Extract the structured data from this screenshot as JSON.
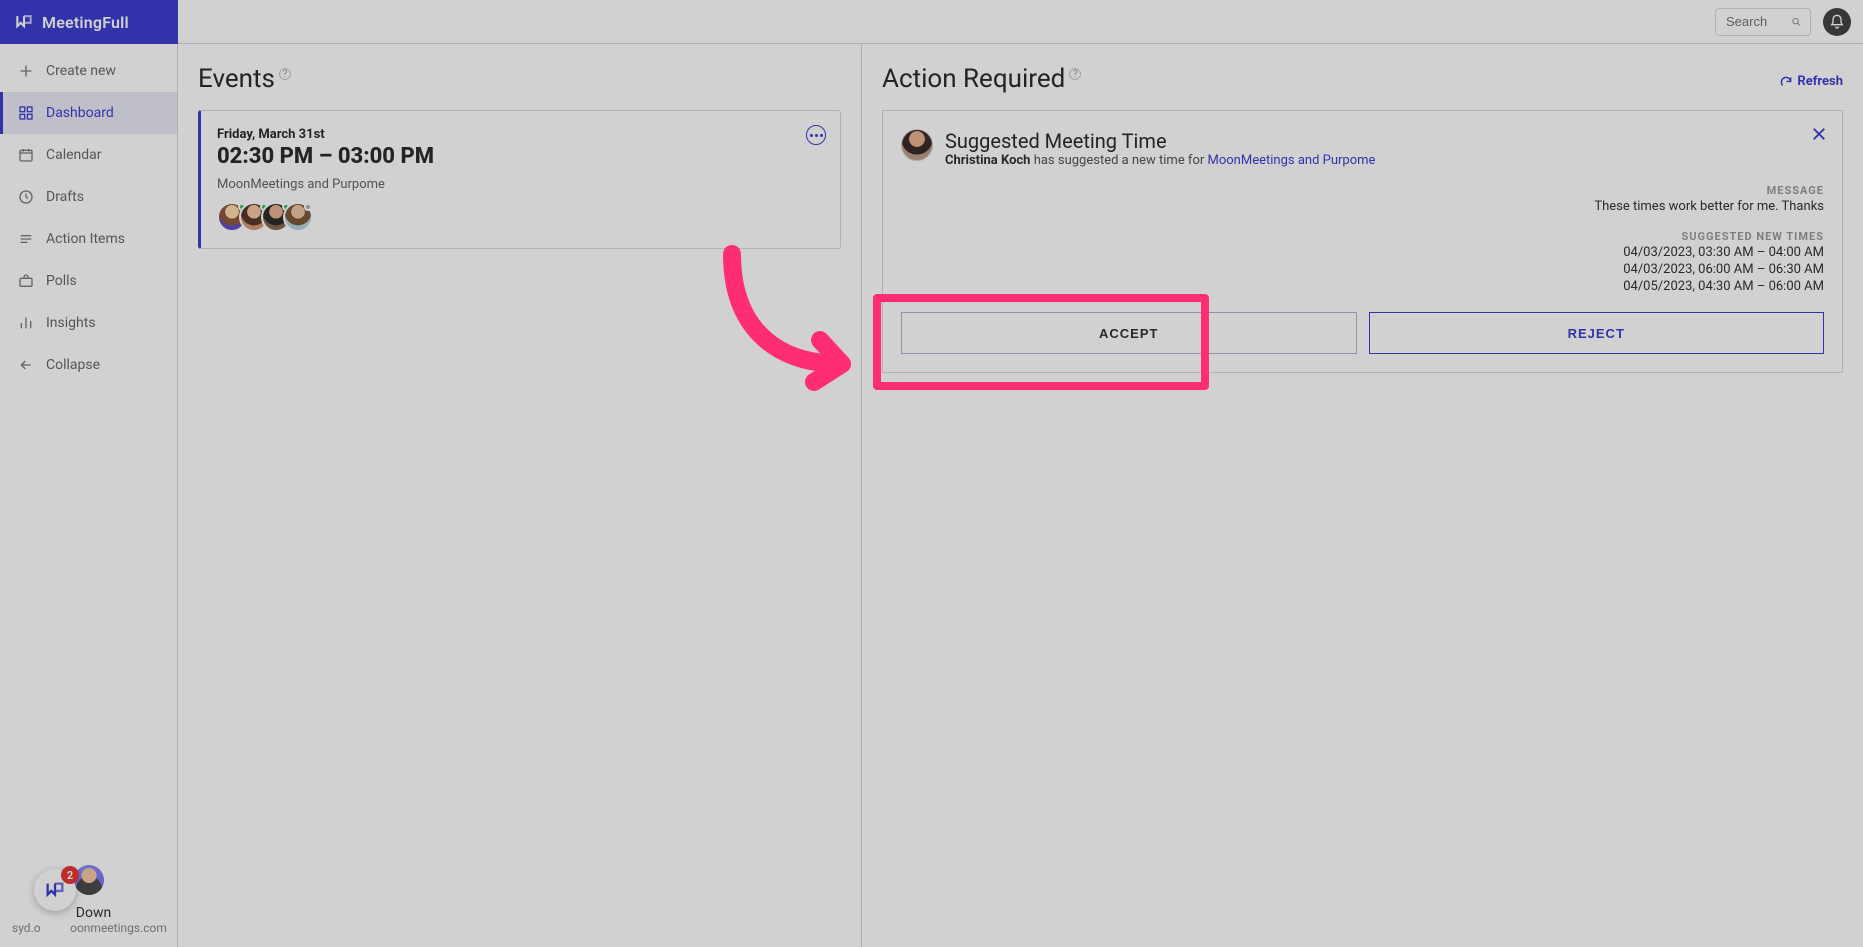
{
  "brand": {
    "name": "MeetingFull"
  },
  "topbar": {
    "search_placeholder": "Search"
  },
  "sidebar": {
    "create_label": "Create new",
    "items": [
      {
        "label": "Dashboard"
      },
      {
        "label": "Calendar"
      },
      {
        "label": "Drafts"
      },
      {
        "label": "Action Items"
      },
      {
        "label": "Polls"
      },
      {
        "label": "Insights"
      }
    ],
    "collapse_label": "Collapse",
    "user": {
      "name_suffix": "Down",
      "email_fragment_left": "syd.o",
      "email_fragment_right": "oonmeetings.com"
    },
    "badge_count": "2"
  },
  "events": {
    "title": "Events",
    "card": {
      "date": "Friday, March 31st",
      "time": "02:30 PM – 03:00 PM",
      "subject": "MoonMeetings and Purpome"
    }
  },
  "action": {
    "title": "Action Required",
    "refresh_label": "Refresh",
    "card": {
      "heading": "Suggested Meeting Time",
      "proposer_name": "Christina Koch",
      "proposer_verb": " has suggested a new time for ",
      "meeting_link": "MoonMeetings and Purpome",
      "message_label": "MESSAGE",
      "message_text": "These times work better for me. Thanks",
      "times_label": "SUGGESTED NEW TIMES",
      "times": [
        "04/03/2023, 03:30 AM – 04:00 AM",
        "04/03/2023, 06:00 AM – 06:30 AM",
        "04/05/2023, 04:30 AM – 06:00 AM"
      ],
      "accept_label": "ACCEPT",
      "reject_label": "REJECT"
    }
  }
}
